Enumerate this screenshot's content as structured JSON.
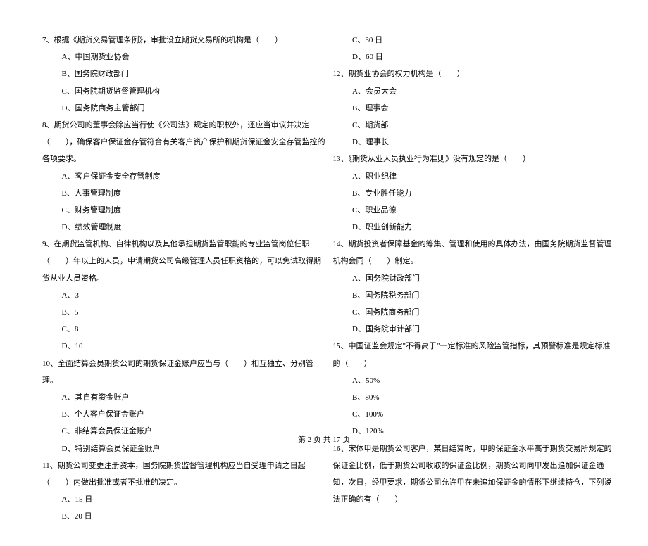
{
  "left": {
    "q7": {
      "text": "7、根据《期货交易管理条例》，审批设立期货交易所的机构是（　　）",
      "opts": [
        "A、中国期货业协会",
        "B、国务院财政部门",
        "C、国务院期货监督管理机构",
        "D、国务院商务主管部门"
      ]
    },
    "q8": {
      "text": "8、期货公司的董事会除应当行使《公司法》规定的职权外，还应当审议并决定（　　），确保客户保证金存管符合有关客户资产保护和期货保证金安全存管监控的各项要求。",
      "opts": [
        "A、客户保证金安全存管制度",
        "B、人事管理制度",
        "C、财务管理制度",
        "D、绩效管理制度"
      ]
    },
    "q9": {
      "text": "9、在期货监管机构、自律机构以及其他承担期货监管职能的专业监管岗位任职（　　）年以上的人员，申请期货公司高级管理人员任职资格的，可以免试取得期货从业人员资格。",
      "opts": [
        "A、3",
        "B、5",
        "C、8",
        "D、10"
      ]
    },
    "q10": {
      "text": "10、全面结算会员期货公司的期货保证金账户应当与（　　）相互独立、分别管理。",
      "opts": [
        "A、其自有资金账户",
        "B、个人客户保证金账户",
        "C、非结算会员保证金账户",
        "D、特别结算会员保证金账户"
      ]
    },
    "q11": {
      "text": "11、期货公司变更注册资本，国务院期货监督管理机构应当自受理申请之日起（　　）内做出批准或者不批准的决定。",
      "opts": [
        "A、15 日",
        "B、20 日"
      ]
    }
  },
  "right": {
    "q11_cont": {
      "opts": [
        "C、30 日",
        "D、60 日"
      ]
    },
    "q12": {
      "text": "12、期货业协会的权力机构是（　　）",
      "opts": [
        "A、会员大会",
        "B、理事会",
        "C、期货部",
        "D、理事长"
      ]
    },
    "q13": {
      "text": "13、《期货从业人员执业行为准则》没有规定的是（　　）",
      "opts": [
        "A、职业纪律",
        "B、专业胜任能力",
        "C、职业品德",
        "D、职业创新能力"
      ]
    },
    "q14": {
      "text": "14、期货投资者保障基金的筹集、管理和使用的具体办法，由国务院期货监督管理机构会同（　　）制定。",
      "opts": [
        "A、国务院财政部门",
        "B、国务院税务部门",
        "C、国务院商务部门",
        "D、国务院审计部门"
      ]
    },
    "q15": {
      "text": "15、中国证监会规定\"不得高于\"一定标准的风险监管指标，其预警标准是规定标准的（　　）",
      "opts": [
        "A、50%",
        "B、80%",
        "C、100%",
        "D、120%"
      ]
    },
    "q16": {
      "text": "16、宋体甲是期货公司客户，某日结算时，甲的保证金水平高于期货交易所规定的保证金比例，低于期货公司收取的保证金比例，期货公司向甲发出追加保证金通知，次日，经甲要求，期货公司允许甲在未追加保证金的情形下继续持仓，下列说法正确的有（　　）"
    }
  },
  "footer": "第 2 页 共 17 页"
}
